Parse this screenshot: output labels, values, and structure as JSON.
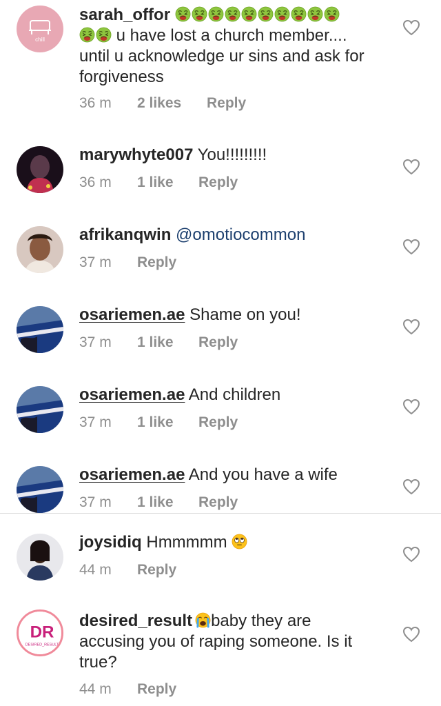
{
  "comments": [
    {
      "username": "sarah_offor",
      "emoji_line1": [
        "nauseated-face",
        "nauseated-face",
        "nauseated-face",
        "nauseated-face",
        "nauseated-face",
        "nauseated-face",
        "nauseated-face",
        "nauseated-face",
        "nauseated-face",
        "nauseated-face"
      ],
      "emoji_line2": [
        "nauseated-face",
        "nauseated-face"
      ],
      "text_after_emoji": " u have lost a church member....",
      "text_line3": "until u acknowledge ur sins and ask for",
      "text_line4": "forgiveness",
      "time": "36 m",
      "likes": "2 likes",
      "reply": "Reply",
      "avatar_label": "chill"
    },
    {
      "username": "marywhyte007",
      "text": " You!!!!!!!!!",
      "time": "36 m",
      "likes": "1 like",
      "reply": "Reply"
    },
    {
      "username": "afrikanqwin",
      "mention": " @omotiocommon",
      "time": "37 m",
      "reply": "Reply"
    },
    {
      "username": "osariemen.ae",
      "text": " Shame on you!",
      "time": "37 m",
      "likes": "1 like",
      "reply": "Reply"
    },
    {
      "username": "osariemen.ae",
      "text": " And children",
      "time": "37 m",
      "likes": "1 like",
      "reply": "Reply"
    },
    {
      "username": "osariemen.ae",
      "text": " And you have a wife",
      "time": "37 m",
      "likes": "1 like",
      "reply": "Reply"
    },
    {
      "username": "joysidiq",
      "text": " Hmmmmm ",
      "emoji": "face-with-rolling-eyes",
      "time": "44 m",
      "reply": "Reply"
    },
    {
      "username": "desired_result",
      "emoji": "loudly-crying-face",
      "text_line1": "baby they are",
      "text_line2": "accusing you of raping someone. Is it",
      "text_line3": "true?",
      "time": "44 m",
      "reply": "Reply",
      "avatar_label": "DESIRED_RESULT"
    }
  ],
  "colors": {
    "text": "#262626",
    "meta": "#8e8e8e",
    "mention": "#1c3f6e",
    "divider": "#dbdbdb"
  }
}
